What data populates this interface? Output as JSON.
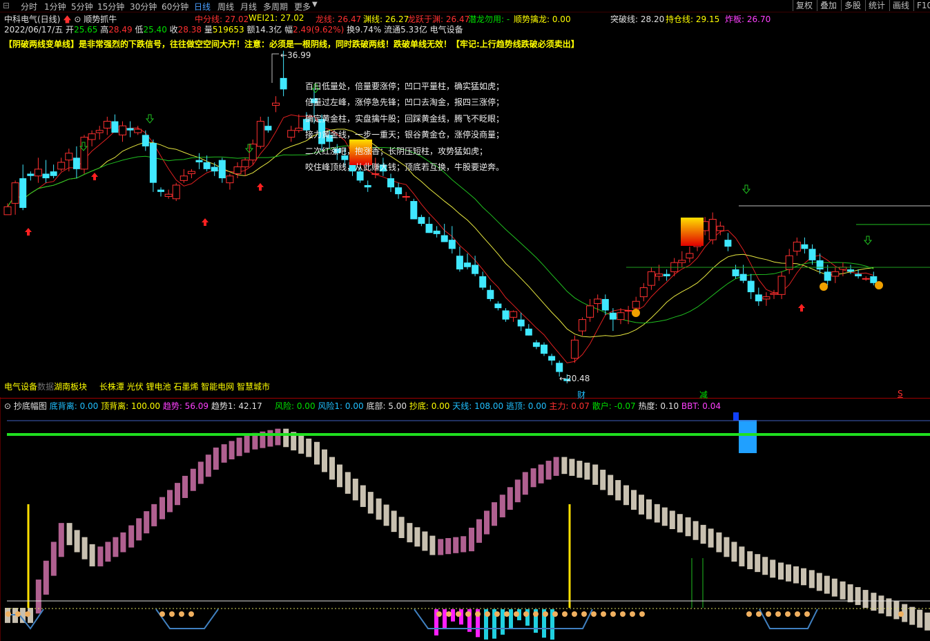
{
  "toolbar": {
    "periods": [
      "分时",
      "1分钟",
      "5分钟",
      "15分钟",
      "30分钟",
      "60分钟",
      "日线",
      "周线",
      "月线",
      "多周期",
      "更多"
    ],
    "active_period": "日线",
    "right_buttons": [
      "复权",
      "叠加",
      "多股",
      "统计",
      "画线",
      "F10"
    ]
  },
  "header": {
    "stock_name": "中科电气(日线)",
    "indicator_name": "顺势抓牛",
    "zhongfen": "中分线: 27.02",
    "wei21": "WEI21: 27.02",
    "longxian": "龙线: 26.47",
    "yuanxian": "渊线: 26.27",
    "longyue": "龙跃于渊: 26.47",
    "qianlong": "潜龙勿用: -",
    "shunshi": "顺势擒龙: 0.00",
    "tupo": "突破线: 28.20",
    "chicang": "持仓线: 29.15",
    "zhaban": "炸板: 26.70"
  },
  "quote": {
    "date": "2022/06/17/五",
    "open_label": "开",
    "open": "25.65",
    "high_label": "高",
    "high": "28.49",
    "low_label": "低",
    "low": "25.40",
    "close_label": "收",
    "close": "28.38",
    "vol_label": "量",
    "vol": "519653",
    "amount_label": "额",
    "amount": "14.3亿",
    "change_label": "幅",
    "change": "2.49(9.62%)",
    "turnover": "换9.74%",
    "float": "流通5.33亿",
    "sector": "电气设备"
  },
  "warning": "【阴破两线变单线】是非常强烈的下跌信号，往往做空空间大开！注意：必须是一根阴线，同时跌破两线！跌破单线无效！【牢记:上行趋势线跌破必须卖出】",
  "poem": [
    "百日低量处，倍量要涨停；凹口平量柱，确实猛如虎；",
    "倍量过左峰，涨停急先锋；凹口去淘金，报四三涨停；",
    "确定黄金柱，实盘擒牛股；回踩黄金线，腾飞不眨眼；",
    "接力黄金线，一步一重天；银谷黄金仓，涨停没商量；",
    "二次红涨吧，抱涨香；长阴压短柱，攻势猛如虎；",
    "咬住峰顶线，从此赚大钱；顶底若互换，牛股要逆奔。"
  ],
  "price_marks": {
    "high": "36.99",
    "low": "20.48"
  },
  "markers": {
    "cai": "财",
    "jian": "减",
    "s": "S"
  },
  "sector_line": {
    "primary": "电气设备",
    "faded": "数据",
    "region": "湖南板块",
    "concepts": "长株潭 光伏 锂电池 石墨烯 智能电网 智慧城市"
  },
  "sub_header": {
    "name": "抄底幅图",
    "dibeili": "底背离: 0.00",
    "dingbeili": "顶背离: 100.00",
    "qushi": "趋势: 56.09",
    "qushi1": "趋势1: 42.17",
    "fengxian": "风险: 0.00",
    "fengxian1": "风险1: 0.00",
    "dibu": "底部: 5.00",
    "chaodi": "抄底: 0.00",
    "tianxian": "天线: 108.00",
    "taoding": "逃顶: 0.00",
    "zhuli": "主力: 0.07",
    "sanhu": "散户: -0.07",
    "redu": "热度: 0.10",
    "bbt": "BBT: 0.04"
  },
  "colors": {
    "up": "#ff3030",
    "down": "#40e8ff",
    "bg": "#000000",
    "ma_red": "#e02020",
    "ma_yellow": "#e8e840",
    "ma_green": "#20c020"
  },
  "candles": [
    [
      22.6,
      23.6,
      23.0,
      23.3
    ],
    [
      23.6,
      25.6,
      22.6,
      25.4
    ],
    [
      25.8,
      27.0,
      23.0,
      23.2
    ],
    [
      26.2,
      26.4,
      25.6,
      26.0
    ],
    [
      26.0,
      27.6,
      25.4,
      26.6
    ],
    [
      26.2,
      27.4,
      25.4,
      25.8
    ],
    [
      26.4,
      27.0,
      25.8,
      26.0
    ],
    [
      26.6,
      27.6,
      26.4,
      27.2
    ],
    [
      27.4,
      28.4,
      26.4,
      28.0
    ],
    [
      27.6,
      28.6,
      25.8,
      26.6
    ],
    [
      26.6,
      29.6,
      26.2,
      29.4
    ],
    [
      29.2,
      30.0,
      28.6,
      29.7
    ],
    [
      29.8,
      30.4,
      29.2,
      30.0
    ],
    [
      30.2,
      31.2,
      29.6,
      30.8
    ],
    [
      30.8,
      31.4,
      29.8,
      29.8
    ],
    [
      29.6,
      30.8,
      29.0,
      30.4
    ],
    [
      30.2,
      30.8,
      29.4,
      30.0
    ],
    [
      29.8,
      30.4,
      29.6,
      30.1
    ],
    [
      29.6,
      30.0,
      28.2,
      28.6
    ],
    [
      28.9,
      29.2,
      24.6,
      25.4
    ],
    [
      24.8,
      25.0,
      24.2,
      24.6
    ],
    [
      24.2,
      24.8,
      24.0,
      24.4
    ],
    [
      24.0,
      25.4,
      23.8,
      25.2
    ],
    [
      25.6,
      26.6,
      25.4,
      26.0
    ],
    [
      26.2,
      26.6,
      25.8,
      26.4
    ],
    [
      27.4,
      28.0,
      26.6,
      27.2
    ],
    [
      27.2,
      27.8,
      26.4,
      26.6
    ],
    [
      26.8,
      27.2,
      26.0,
      26.4
    ],
    [
      27.4,
      27.6,
      25.4,
      25.8
    ],
    [
      25.4,
      26.2,
      24.8,
      26.0
    ],
    [
      26.2,
      27.2,
      25.8,
      26.8
    ],
    [
      26.8,
      27.6,
      26.0,
      27.4
    ],
    [
      27.4,
      29.2,
      27.0,
      28.8
    ],
    [
      28.6,
      31.2,
      28.4,
      30.8
    ],
    [
      30.4,
      31.2,
      29.8,
      30.0
    ],
    [
      32.2,
      33.0,
      31.6,
      32.4
    ],
    [
      34.6,
      36.99,
      33.0,
      33.6
    ],
    [
      29.4,
      30.4,
      29.0,
      30.0
    ],
    [
      30.0,
      31.4,
      29.8,
      30.2
    ],
    [
      31.0,
      31.6,
      29.8,
      30.0
    ],
    [
      32.8,
      33.8,
      30.6,
      32.4
    ],
    [
      31.0,
      31.4,
      28.2,
      28.8
    ],
    [
      29.6,
      30.0,
      28.4,
      29.0
    ],
    [
      28.4,
      28.8,
      27.4,
      28.0
    ],
    [
      27.8,
      28.4,
      26.8,
      27.4
    ],
    [
      27.2,
      27.6,
      26.0,
      26.4
    ],
    [
      26.4,
      26.8,
      25.4,
      25.6
    ],
    [
      25.2,
      25.6,
      24.6,
      25.0
    ],
    [
      26.2,
      27.6,
      25.8,
      26.2
    ],
    [
      27.0,
      27.6,
      26.0,
      26.4
    ],
    [
      25.8,
      26.2,
      24.6,
      25.0
    ],
    [
      25.0,
      25.4,
      24.0,
      24.4
    ],
    [
      24.2,
      24.6,
      23.8,
      24.2
    ],
    [
      23.8,
      24.0,
      22.2,
      22.2
    ],
    [
      22.4,
      22.6,
      21.6,
      21.8
    ],
    [
      21.8,
      22.4,
      21.0,
      21.0
    ],
    [
      21.2,
      21.6,
      20.6,
      20.9
    ],
    [
      20.8,
      21.8,
      20.2,
      20.2
    ],
    [
      20.4,
      21.6,
      19.2,
      19.6
    ],
    [
      19.0,
      19.8,
      17.6,
      17.8
    ],
    [
      18.4,
      19.2,
      17.8,
      18.0
    ],
    [
      18.2,
      19.0,
      17.2,
      17.4
    ],
    [
      17.2,
      17.6,
      16.0,
      16.2
    ],
    [
      16.0,
      16.4,
      15.0,
      15.2
    ],
    [
      14.8,
      15.0,
      14.2,
      14.4
    ],
    [
      14.2,
      14.4,
      13.2,
      13.4
    ],
    [
      13.6,
      14.2,
      13.2,
      14.1
    ],
    [
      13.4,
      14.0,
      12.4,
      12.8
    ],
    [
      12.6,
      13.0,
      12.0,
      12.0
    ],
    [
      11.4,
      11.6,
      10.8,
      11.0
    ],
    [
      11.2,
      11.4,
      10.2,
      10.4
    ],
    [
      10.2,
      10.4,
      9.4,
      9.8
    ],
    [
      9.6,
      9.8,
      8.4,
      8.8
    ],
    [
      8.2,
      8.6,
      7.8,
      8.0
    ],
    [
      10.0,
      12.0,
      9.6,
      11.6
    ],
    [
      12.4,
      13.6,
      12.0,
      13.4
    ],
    [
      13.6,
      15.2,
      13.2,
      14.6
    ],
    [
      14.8,
      15.6,
      14.0,
      15.2
    ],
    [
      15.2,
      15.6,
      13.8,
      14.2
    ],
    [
      14.0,
      14.4,
      12.4,
      13.4
    ],
    [
      13.4,
      14.4,
      13.0,
      14.0
    ],
    [
      14.2,
      14.6,
      13.0,
      14.2
    ],
    [
      14.4,
      15.4,
      13.8,
      15.0
    ],
    [
      15.4,
      16.6,
      15.0,
      16.2
    ],
    [
      16.4,
      18.0,
      16.0,
      17.6
    ],
    [
      17.2,
      18.2,
      16.8,
      17.4
    ],
    [
      17.4,
      17.8,
      16.8,
      17.2
    ],
    [
      17.6,
      18.8,
      17.2,
      18.4
    ],
    [
      18.4,
      19.4,
      18.0,
      18.6
    ],
    [
      18.8,
      19.8,
      18.4,
      19.2
    ],
    [
      19.8,
      21.0,
      19.4,
      20.6
    ],
    [
      21.2,
      22.4,
      20.8,
      22.0
    ],
    [
      20.4,
      22.8,
      20.0,
      22.2
    ],
    [
      21.2,
      22.0,
      20.8,
      21.6
    ],
    [
      20.4,
      21.0,
      19.4,
      19.8
    ],
    [
      17.8,
      18.2,
      17.0,
      17.2
    ],
    [
      17.4,
      18.2,
      16.6,
      16.8
    ],
    [
      16.8,
      17.4,
      15.2,
      15.8
    ],
    [
      15.6,
      16.2,
      14.6,
      15.0
    ],
    [
      15.2,
      15.8,
      14.6,
      15.4
    ],
    [
      15.6,
      16.0,
      15.2,
      15.7
    ],
    [
      15.6,
      17.6,
      15.2,
      17.2
    ],
    [
      17.8,
      19.6,
      17.4,
      19.0
    ],
    [
      19.4,
      20.6,
      19.0,
      20.2
    ],
    [
      20.0,
      20.6,
      19.2,
      19.6
    ],
    [
      19.6,
      20.0,
      18.2,
      18.6
    ],
    [
      18.6,
      19.2,
      17.4,
      17.8
    ],
    [
      17.6,
      18.2,
      16.4,
      16.8
    ],
    [
      17.2,
      18.0,
      16.6,
      17.6
    ],
    [
      17.8,
      18.4,
      17.2,
      18.0
    ],
    [
      17.8,
      18.2,
      17.4,
      17.6
    ],
    [
      17.4,
      17.8,
      17.0,
      17.2
    ],
    [
      17.0,
      17.2,
      16.8,
      17.0
    ],
    [
      17.2,
      17.6,
      16.4,
      16.6
    ]
  ],
  "sub_bars": [
    [
      0.0,
      0.0,
      1
    ],
    [
      0.05,
      0.45,
      0
    ],
    [
      0.45,
      0.3,
      1
    ],
    [
      0.3,
      0.4,
      0
    ],
    [
      0.4,
      0.55,
      0
    ],
    [
      0.55,
      0.7,
      0
    ],
    [
      0.7,
      0.85,
      0
    ],
    [
      0.85,
      0.92,
      0
    ],
    [
      0.92,
      0.95,
      0
    ],
    [
      0.95,
      0.88,
      1
    ],
    [
      0.88,
      0.72,
      1
    ],
    [
      0.72,
      0.58,
      1
    ],
    [
      0.58,
      0.45,
      1
    ],
    [
      0.45,
      0.36,
      1
    ],
    [
      0.36,
      0.38,
      0
    ],
    [
      0.38,
      0.56,
      0
    ],
    [
      0.56,
      0.72,
      0
    ],
    [
      0.72,
      0.8,
      0
    ],
    [
      0.8,
      0.76,
      1
    ],
    [
      0.76,
      0.65,
      1
    ],
    [
      0.65,
      0.55,
      1
    ],
    [
      0.55,
      0.48,
      1
    ],
    [
      0.48,
      0.4,
      1
    ],
    [
      0.4,
      0.3,
      1
    ],
    [
      0.3,
      0.24,
      1
    ],
    [
      0.24,
      0.2,
      1
    ],
    [
      0.2,
      0.14,
      1
    ],
    [
      0.14,
      0.08,
      1
    ],
    [
      0.08,
      0.02,
      1
    ],
    [
      0.02,
      -0.04,
      1
    ]
  ]
}
